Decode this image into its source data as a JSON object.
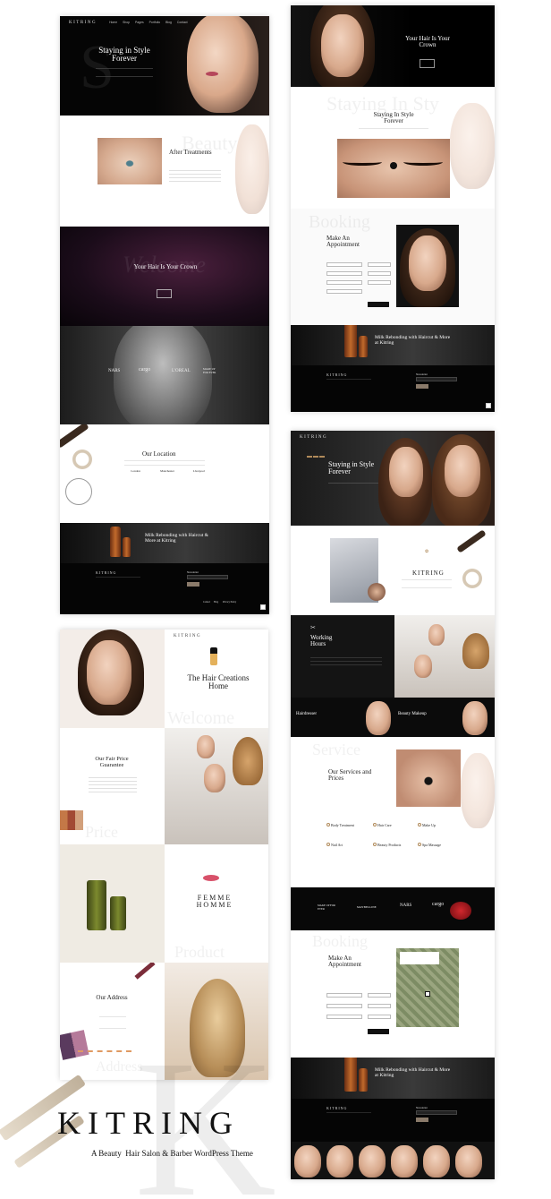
{
  "brand": {
    "name": "KITRING",
    "tagline": "A Beauty  Hair Salon & Barber WordPress Theme"
  },
  "nav": [
    "Home",
    "Shop",
    "Pages",
    "Portfolio",
    "Blog",
    "Contact"
  ],
  "mock1": {
    "hero_title": "Staying in Style Forever",
    "after_title": "After Treatments",
    "after_watermark": "Beauty",
    "crown_title": "Your Hair Is Your Crown",
    "brands": [
      "NARS",
      "cargo",
      "L'OREAL",
      "MAKE UP FOR EVER"
    ],
    "location_title": "Our Location",
    "locations": [
      "London",
      "Manchester",
      "Liverpool"
    ],
    "promo_title": "Milk Rebonding with Haircut & More at Kitring",
    "footer_logo": "KITRING",
    "newsletter": "Newsletter",
    "footer_links": [
      "Contact",
      "Blog",
      "Privacy Policy"
    ]
  },
  "mock2": {
    "hero_title": "Your Hair Is Your Crown",
    "watermark": "Staying In Sty",
    "subtitle": "Staying In Style Forever",
    "booking_watermark": "Booking",
    "appointment_title": "Make An Appointment",
    "promo_title": "Milk Rebonding with Haircut & More at Kitring",
    "footer_logo": "KITRING",
    "newsletter": "Newsletter"
  },
  "mock3": {
    "hero_title": "Staying in Style Forever",
    "about_logo": "KITRING",
    "working_title": "Working Hours",
    "hairdresser": "Hairdresser",
    "beauty_makeup": "Beauty Makeup",
    "services_watermark": "Service",
    "services_title": "Our Services and Prices",
    "services": [
      "Body Treatment",
      "Hair Care",
      "Make Up",
      "Nail Art",
      "Beauty Products",
      "Spa Massage"
    ],
    "brands": [
      "MAKE UP FOR EVER",
      "MAYBELLINE",
      "NARS",
      "cargo"
    ],
    "booking_watermark": "Booking",
    "appointment_title": "Make An Appointment",
    "promo_title": "Milk Rebonding with Haircut & More at Kitring",
    "footer_logo": "KITRING",
    "newsletter": "Newsletter"
  },
  "mock4": {
    "logo": "KITRING",
    "hero_title": "The Hair Creations Home",
    "welcome_watermark": "Welcome",
    "price_title": "Our Fair Price Guarantee",
    "price_watermark": "Price",
    "femme": "FEMME HOMME",
    "product_watermark": "Product",
    "address_title": "Our Address",
    "address_watermark": "Address"
  },
  "colors": {
    "accent_gold": "#b08a5a",
    "dark": "#0d0d0d",
    "lip_red": "#b5475b",
    "light_bg": "#f6f5f3"
  }
}
